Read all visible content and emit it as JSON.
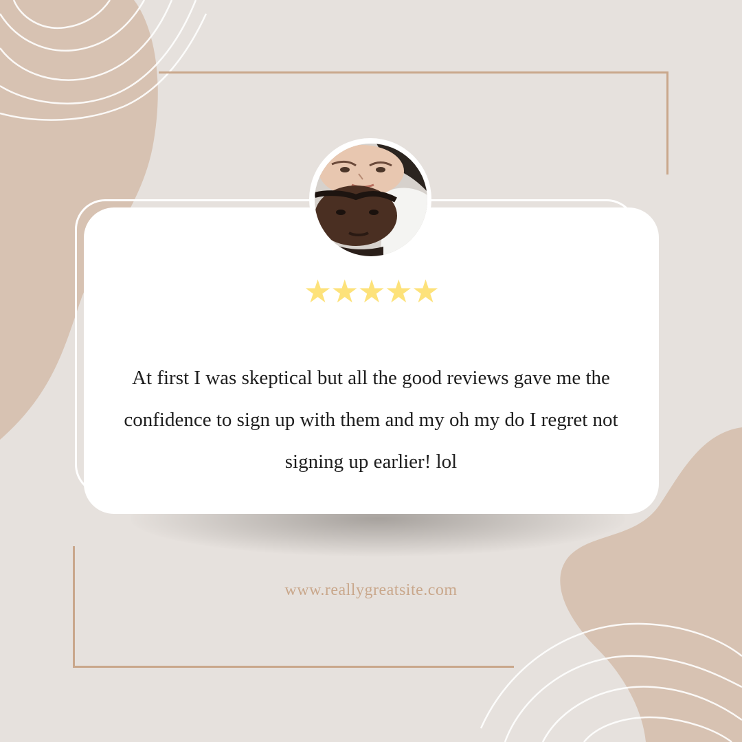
{
  "rating": {
    "stars_text": "★★★★★",
    "value": 5,
    "max": 5
  },
  "review": {
    "text": "At first I was skeptical but all the good reviews gave me the confidence to sign up with them and my oh my do I regret not signing up earlier! lol"
  },
  "footer": {
    "website": "www.reallygreatsite.com"
  },
  "avatar": {
    "icon": "reviewer-photo"
  },
  "colors": {
    "background": "#e6e1dd",
    "accent_shape": "#d7c2b2",
    "frame_line": "#c9a78b",
    "card": "#ffffff",
    "star": "#fde27a",
    "text": "#1f1f1f",
    "website_text": "#c9a78b"
  }
}
